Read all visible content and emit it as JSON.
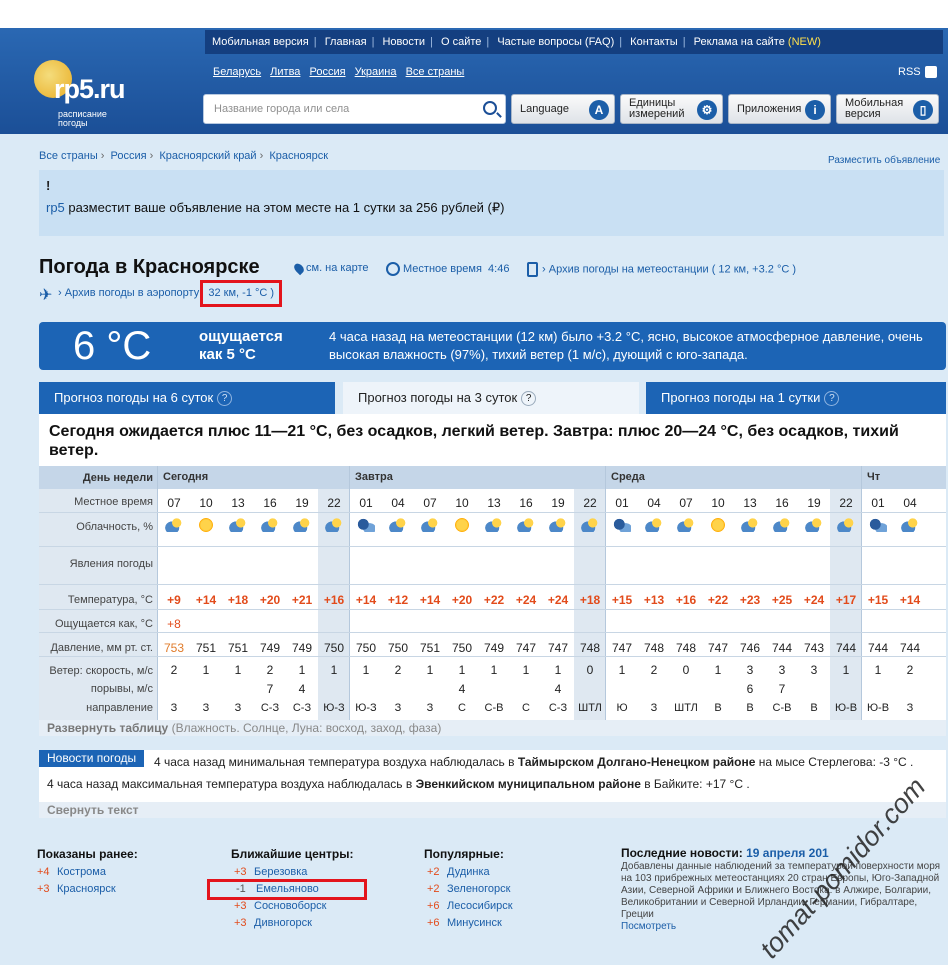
{
  "topnav": [
    "Мобильная версия",
    "Главная",
    "Новости",
    "О сайте",
    "Частые вопросы (FAQ)",
    "Контакты",
    "Реклама на сайте"
  ],
  "topnav_new": "(NEW)",
  "countries": [
    "Беларусь",
    "Литва",
    "Россия",
    "Украина",
    "Все страны"
  ],
  "rss": "RSS",
  "logo": {
    "text": "rp5.ru",
    "sub": "расписание погоды"
  },
  "search_placeholder": "Название города или села",
  "buttons": {
    "language": "Language",
    "units": "Единицы измерений",
    "apps": "Приложения",
    "mobile": "Мобильная версия"
  },
  "breadcrumbs": [
    "Все страны",
    "Россия",
    "Красноярский край",
    "Красноярск"
  ],
  "ad_link": "Разместить объявление",
  "ad": {
    "excl": "!",
    "brand": "rp5",
    "text": " разместит ваше объявление на этом месте на 1 сутки за 256 рублей (₽)"
  },
  "title": "Погода в Красноярске",
  "map_link": "см. на карте",
  "local_time_label": "Местное время",
  "local_time": "4:46",
  "archive_station": "Архив погоды на метеостанции",
  "archive_station_detail": "( 12 км, +3.2 °С )",
  "archive_airport": "Архив погоды в аэропорту",
  "archive_airport_detail": "32 км, -1 °С )",
  "now": {
    "temp": "6 °C",
    "feels_label": "ощущается",
    "feels": "как 5 °С",
    "desc": "4 часа назад на метеостанции (12 км) было +3.2 °С, ясно, высокое атмосферное давление, очень высокая влажность (97%), тихий ветер (1 м/с), дующий с юго-запада."
  },
  "tabs": [
    "Прогноз погоды на 6 суток",
    "Прогноз погоды на 3 суток",
    "Прогноз погоды на 1 сутки"
  ],
  "summary": "Сегодня ожидается плюс 11—21 °С, без осадков, легкий ветер. Завтра: плюс 20—24 °С, без осадков, тихий ветер.",
  "labels": {
    "day": "День недели",
    "time": "Местное время",
    "cloud": "Облачность, %",
    "phen": "Явления погоды",
    "temp": "Температура, °С",
    "feels": "Ощущается как, °С",
    "press": "Давление, мм рт. ст.",
    "wind": "Ветер: скорость, м/с",
    "gust": "порывы, м/с",
    "dir": "направление"
  },
  "days": [
    "Сегодня",
    "Завтра",
    "Среда",
    "Чт"
  ],
  "times": [
    "07",
    "10",
    "13",
    "16",
    "19",
    "22",
    "01",
    "04",
    "07",
    "10",
    "13",
    "16",
    "19",
    "22",
    "01",
    "04",
    "07",
    "10",
    "13",
    "16",
    "19",
    "22",
    "01",
    "04"
  ],
  "clouds": [
    "c",
    "s",
    "c",
    "c",
    "c",
    "c",
    "m",
    "c",
    "c",
    "s",
    "c",
    "c",
    "c",
    "c",
    "m",
    "c",
    "c",
    "s",
    "c",
    "c",
    "c",
    "c",
    "m",
    "c"
  ],
  "temps": [
    "+9",
    "+14",
    "+18",
    "+20",
    "+21",
    "+16",
    "+14",
    "+12",
    "+14",
    "+20",
    "+22",
    "+24",
    "+24",
    "+18",
    "+15",
    "+13",
    "+16",
    "+22",
    "+23",
    "+25",
    "+24",
    "+17",
    "+15",
    "+14"
  ],
  "feels": [
    "+8"
  ],
  "pressure": [
    "753",
    "751",
    "751",
    "749",
    "749",
    "750",
    "750",
    "750",
    "751",
    "750",
    "749",
    "747",
    "747",
    "748",
    "747",
    "748",
    "748",
    "747",
    "746",
    "744",
    "743",
    "744",
    "744",
    "744"
  ],
  "wind": [
    "2",
    "1",
    "1",
    "2",
    "1",
    "1",
    "1",
    "2",
    "1",
    "1",
    "1",
    "1",
    "1",
    "0",
    "1",
    "2",
    "0",
    "1",
    "3",
    "3",
    "3",
    "1",
    "1",
    "2"
  ],
  "gusts": [
    "",
    "",
    "",
    "7",
    "4",
    "",
    "",
    "",
    "",
    "4",
    "",
    "",
    "4",
    "",
    "",
    "",
    "",
    "",
    "6",
    "7",
    "",
    "",
    "",
    ""
  ],
  "directions": [
    "З",
    "З",
    "З",
    "С-З",
    "С-З",
    "Ю-З",
    "Ю-З",
    "З",
    "З",
    "С",
    "С-В",
    "С",
    "С-З",
    "ШТЛ",
    "Ю",
    "З",
    "ШТЛ",
    "В",
    "В",
    "С-В",
    "В",
    "Ю-В",
    "Ю-В",
    "З"
  ],
  "expand": "Развернуть таблицу",
  "expand_hint": "(Влажность. Солнце, Луна: восход, заход, фаза)",
  "news_tag": "Новости погоды",
  "news1": {
    "a": "4 часа назад минимальная температура воздуха наблюдалась в ",
    "b": "Таймырском Долгано-Ненецком районе",
    "c": " на мысе Стерлегова: -3 °С ."
  },
  "news2": {
    "a": "4 часа назад максимальная температура воздуха наблюдалась в ",
    "b": "Эвенкийском муниципальном районе",
    "c": " в Байките: +17 °С ."
  },
  "collapse": "Свернуть текст",
  "shown_title": "Показаны ранее:",
  "shown": [
    {
      "n": "+4",
      "t": "Кострома"
    },
    {
      "n": "+3",
      "t": "Красноярск"
    }
  ],
  "near_title": "Ближайшие центры:",
  "near": [
    {
      "n": "+3",
      "t": "Березовка"
    },
    {
      "n": "-1",
      "t": "Емельяново"
    },
    {
      "n": "+3",
      "t": "Сосновоборск"
    },
    {
      "n": "+3",
      "t": "Дивногорск"
    }
  ],
  "pop_title": "Популярные:",
  "popular": [
    {
      "n": "+2",
      "t": "Дудинка"
    },
    {
      "n": "+2",
      "t": "Зеленогорск"
    },
    {
      "n": "+6",
      "t": "Лесосибирск"
    },
    {
      "n": "+6",
      "t": "Минусинск"
    }
  ],
  "lastnews_title": "Последние новости:",
  "lastnews_date": "19 апреля 201",
  "lastnews_text": "Добавлены данные наблюдений за температурой поверхности моря на 103 прибрежных метеостанциях 20 стран Европы, Юго-Западной Азии, Северной Африки и Ближнего Востока: в Алжире, Болгарии, Великобритании и Северной Ирландии, Германии, Гибралтаре, Греции",
  "lastnews_more": "Посмотреть",
  "watermark": "tomat-pomidor.com"
}
